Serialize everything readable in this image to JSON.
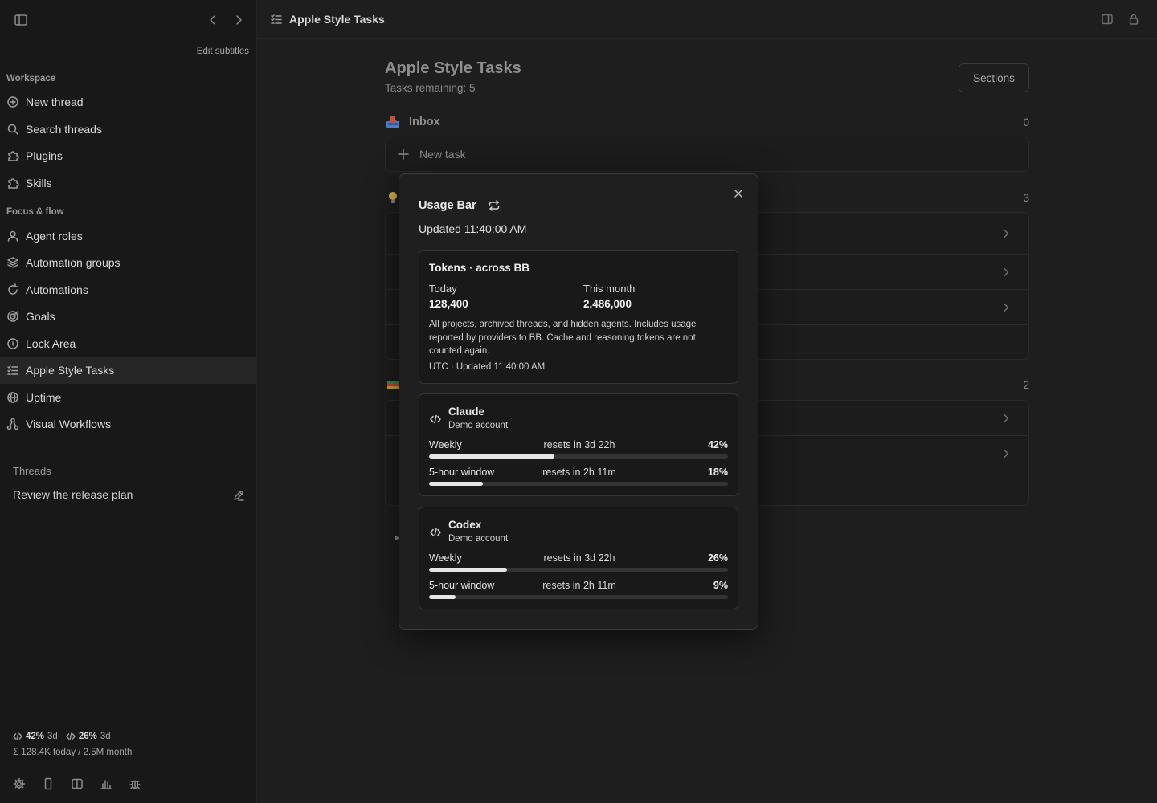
{
  "sidebar": {
    "edit_subtitles": "Edit subtitles",
    "workspace_label": "Workspace",
    "workspace_items": [
      {
        "label": "New thread",
        "icon": "plus-circle-icon"
      },
      {
        "label": "Search threads",
        "icon": "search-icon"
      },
      {
        "label": "Plugins",
        "icon": "puzzle-icon"
      },
      {
        "label": "Skills",
        "icon": "puzzle-icon"
      }
    ],
    "focus_label": "Focus & flow",
    "focus_items": [
      {
        "label": "Agent roles",
        "icon": "user-icon"
      },
      {
        "label": "Automation groups",
        "icon": "layers-icon"
      },
      {
        "label": "Automations",
        "icon": "loop-icon"
      },
      {
        "label": "Goals",
        "icon": "target-icon"
      },
      {
        "label": "Lock Area",
        "icon": "lock-circle-icon"
      },
      {
        "label": "Apple Style Tasks",
        "icon": "checklist-icon"
      },
      {
        "label": "Uptime",
        "icon": "globe-icon"
      },
      {
        "label": "Visual Workflows",
        "icon": "workflow-icon"
      }
    ],
    "threads_label": "Threads",
    "thread_item": "Review the release plan",
    "usage": {
      "claude_pct": "42%",
      "claude_reset": "3d",
      "codex_pct": "26%",
      "codex_reset": "3d",
      "tokens_summary": "Σ 128.4K today / 2.5M month"
    }
  },
  "main": {
    "topbar_title": "Apple Style Tasks",
    "page_title": "Apple Style Tasks",
    "tasks_remaining": "Tasks remaining: 5",
    "sections_button": "Sections",
    "inbox": {
      "name": "Inbox",
      "count": "0"
    },
    "new_task": "New task",
    "section2_count": "3",
    "section3_count": "2"
  },
  "dialog": {
    "title": "Usage Bar",
    "updated": "Updated 11:40:00 AM",
    "tokens": {
      "title": "Tokens · across BB",
      "today_label": "Today",
      "today_value": "128,400",
      "month_label": "This month",
      "month_value": "2,486,000",
      "note": "All projects, archived threads, and hidden agents. Includes usage reported by providers to BB. Cache and reasoning tokens are not counted again.",
      "footer": "UTC · Updated 11:40:00 AM"
    },
    "providers": [
      {
        "name": "Claude",
        "account": "Demo account",
        "rows": [
          {
            "label": "Weekly",
            "reset": "resets in 3d 22h",
            "pct_text": "42%",
            "pct": 42
          },
          {
            "label": "5-hour window",
            "reset": "resets in 2h 11m",
            "pct_text": "18%",
            "pct": 18
          }
        ]
      },
      {
        "name": "Codex",
        "account": "Demo account",
        "rows": [
          {
            "label": "Weekly",
            "reset": "resets in 3d 22h",
            "pct_text": "26%",
            "pct": 26
          },
          {
            "label": "5-hour window",
            "reset": "resets in 2h 11m",
            "pct_text": "9%",
            "pct": 9
          }
        ]
      }
    ]
  },
  "colors": {
    "background": "#1e1e1e",
    "sidebar": "#181818",
    "bar_fill": "#e6e6e6",
    "bar_track": "#333333"
  }
}
